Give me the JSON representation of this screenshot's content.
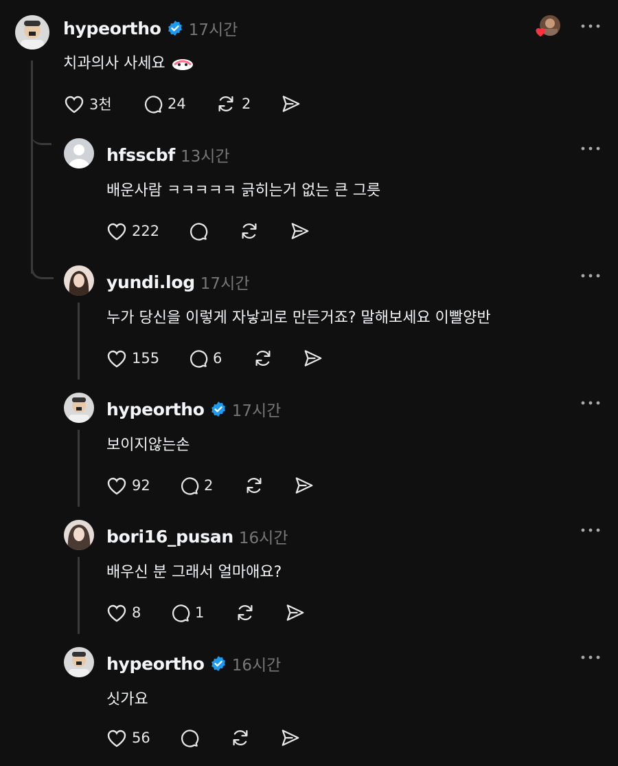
{
  "colors": {
    "background": "#101010",
    "verified": "#1d9bf0",
    "muted": "#777777",
    "line": "#3a3a3a"
  },
  "main_post": {
    "username": "hypeortho",
    "time": "17시간",
    "text": "치과의사 사세요",
    "likes": "3천",
    "replies": "24",
    "reposts": "2",
    "liker_avatar_icon": "liked-by-avatar-with-heart"
  },
  "replies": [
    {
      "username": "hfsscbf",
      "time": "13시간",
      "text": "배운사람 ㅋㅋㅋㅋㅋ 긁히는거 없는 큰 그릇",
      "likes": "222",
      "replies": "",
      "verified": false
    },
    {
      "username": "yundi.log",
      "time": "17시간",
      "text": "누가 당신을 이렇게 자낳괴로 만든거죠? 말해보세요 이빨양반",
      "likes": "155",
      "replies": "6",
      "verified": false
    },
    {
      "username": "hypeortho",
      "time": "17시간",
      "text": "보이지않는손",
      "likes": "92",
      "replies": "2",
      "verified": true
    },
    {
      "username": "bori16_pusan",
      "time": "16시간",
      "text": "배우신 분 그래서 얼마애요?",
      "likes": "8",
      "replies": "1",
      "verified": false
    },
    {
      "username": "hypeortho",
      "time": "16시간",
      "text": "싯가요",
      "likes": "56",
      "replies": "",
      "verified": true
    }
  ]
}
